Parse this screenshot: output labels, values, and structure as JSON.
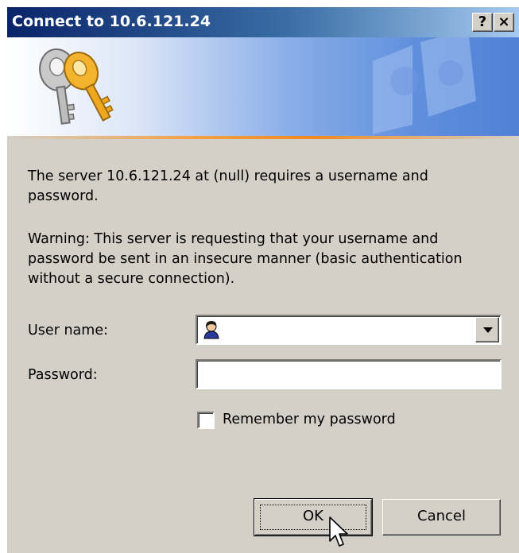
{
  "window": {
    "title": "Connect to 10.6.121.24",
    "help_button": "?",
    "close_button": "×"
  },
  "banner": {
    "icon": "keys-icon",
    "watermark": "network-logo-watermark"
  },
  "message": {
    "line1": "The server 10.6.121.24 at (null) requires a username and",
    "line2": "password.",
    "warning1": "Warning: This server is requesting that your username and",
    "warning2": "password be sent in an insecure manner (basic authentication",
    "warning3": "without a secure connection)."
  },
  "form": {
    "username_label": "User name:",
    "username_value": "",
    "username_icon": "user-icon",
    "password_label": "Password:",
    "password_value": "",
    "remember_label": "Remember my password",
    "remember_checked": false
  },
  "buttons": {
    "ok": "OK",
    "cancel": "Cancel"
  },
  "colors": {
    "title_start": "#0a246a",
    "title_end": "#a6caf0",
    "dialog_bg": "#d4d0c8",
    "banner_accent": "#f08a20"
  }
}
